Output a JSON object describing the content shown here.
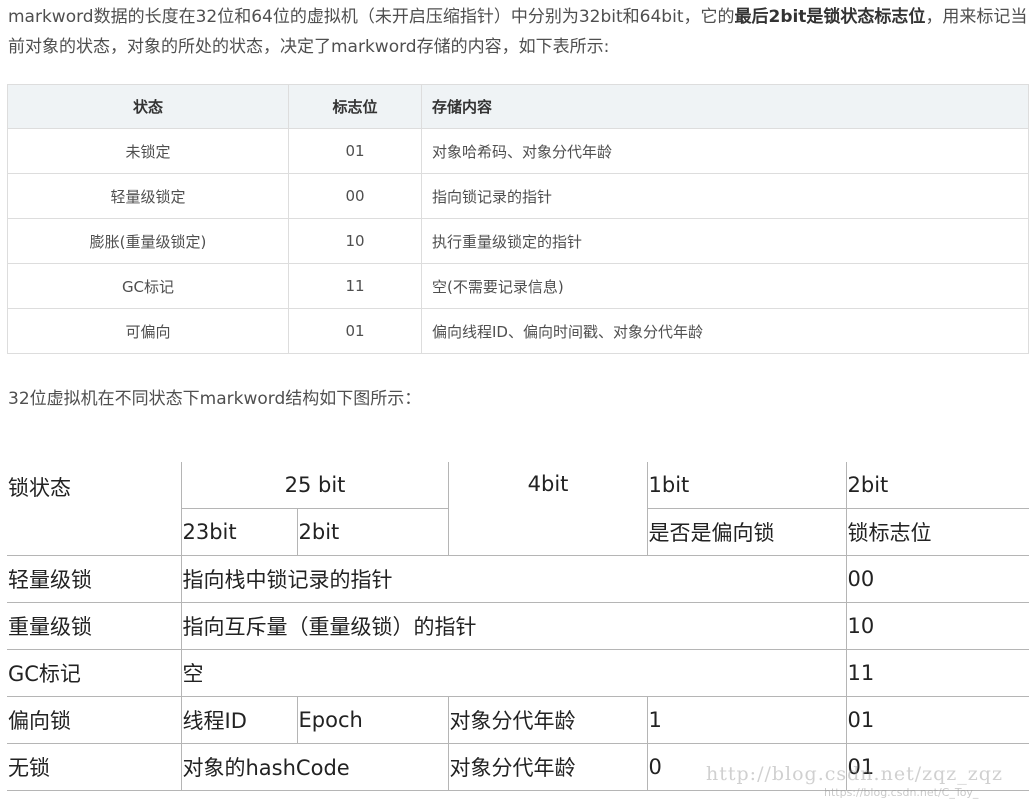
{
  "intro": {
    "part1": "markword数据的长度在32位和64位的虚拟机（未开启压缩指针）中分别为32bit和64bit，它的",
    "bold": "最后2bit是锁状态标志位",
    "part2": "，用来标记当前对象的状态，对象的所处的状态，决定了markword存储的内容，如下表所示:"
  },
  "table1": {
    "headers": [
      "状态",
      "标志位",
      "存储内容"
    ],
    "rows": [
      [
        "未锁定",
        "01",
        "对象哈希码、对象分代年龄"
      ],
      [
        "轻量级锁定",
        "00",
        "指向锁记录的指针"
      ],
      [
        "膨胀(重量级锁定)",
        "10",
        "执行重量级锁定的指针"
      ],
      [
        "GC标记",
        "11",
        "空(不需要记录信息)"
      ],
      [
        "可偏向",
        "01",
        "偏向线程ID、偏向时间戳、对象分代年龄"
      ]
    ]
  },
  "caption": "32位虚拟机在不同状态下markword结构如下图所示：",
  "table2": {
    "h_state": "锁状态",
    "h_25bit": "25 bit",
    "h_4bit": "4bit",
    "h_1bit": "1bit",
    "h_2bit": "2bit",
    "h_23bit": "23bit",
    "h_2bit_sub": "2bit",
    "h_biased": "是否是偏向锁",
    "h_flag": "锁标志位",
    "light": {
      "name": "轻量级锁",
      "content": "指向栈中锁记录的指针",
      "flag": "00"
    },
    "heavy": {
      "name": "重量级锁",
      "content": "指向互斥量（重量级锁）的指针",
      "flag": "10"
    },
    "gc": {
      "name": "GC标记",
      "content": "空",
      "flag": "11"
    },
    "biased": {
      "name": "偏向锁",
      "thread": "线程ID",
      "epoch": "Epoch",
      "age": "对象分代年龄",
      "bit": "1",
      "flag": "01"
    },
    "nolock": {
      "name": "无锁",
      "hash": "对象的hashCode",
      "age": "对象分代年龄",
      "bit": "0",
      "flag": "01"
    }
  },
  "watermark": "http://blog.csdn.net/zqz_zqz",
  "watermark_small": "https://blog.csdn.net/C_Toy_"
}
